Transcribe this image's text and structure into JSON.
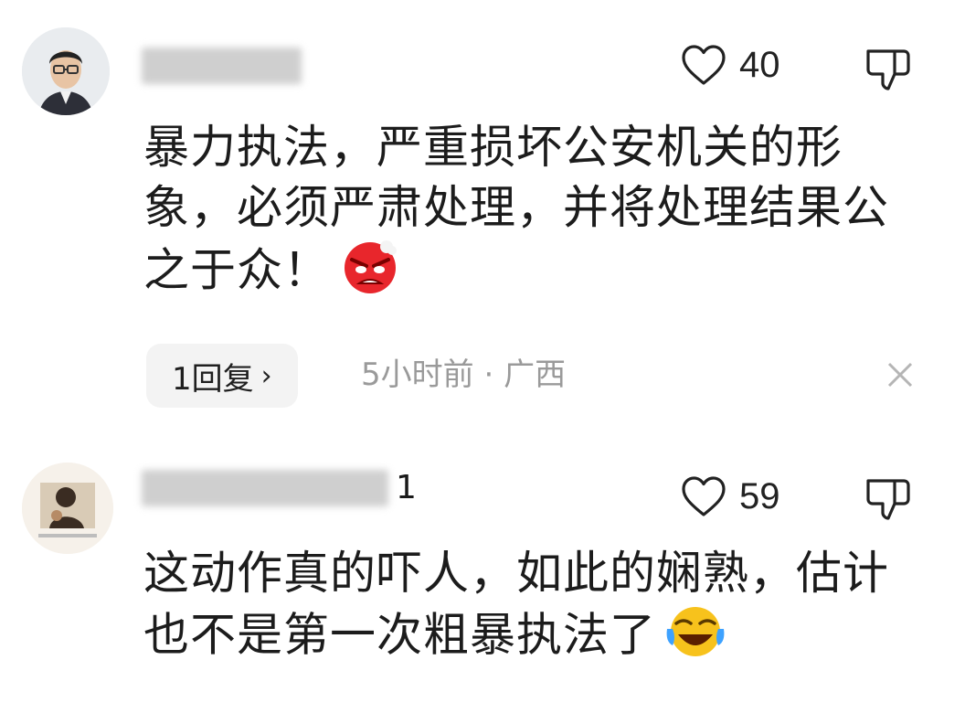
{
  "comments": [
    {
      "username_tail": "",
      "likes": "40",
      "text": "暴力执法，严重损坏公安机关的形象，必须严肃处理，并将处理结果公之于众！",
      "emoji": "angry-face-emoji",
      "reply_label": "1回复",
      "reply_arrow": "›",
      "time": "5小时前",
      "separator": "·",
      "location": "广西"
    },
    {
      "username_tail": "1",
      "likes": "59",
      "text": "这动作真的吓人，如此的娴熟，估计也不是第一次粗暴执法了",
      "emoji": "laughing-crying-emoji"
    }
  ],
  "colors": {
    "text": "#1c1c1c",
    "meta": "#9a9a9a",
    "pill": "#f3f3f3",
    "icon": "#222222",
    "emoji_red": "#e8262c",
    "emoji_yellow": "#f7c21c"
  }
}
